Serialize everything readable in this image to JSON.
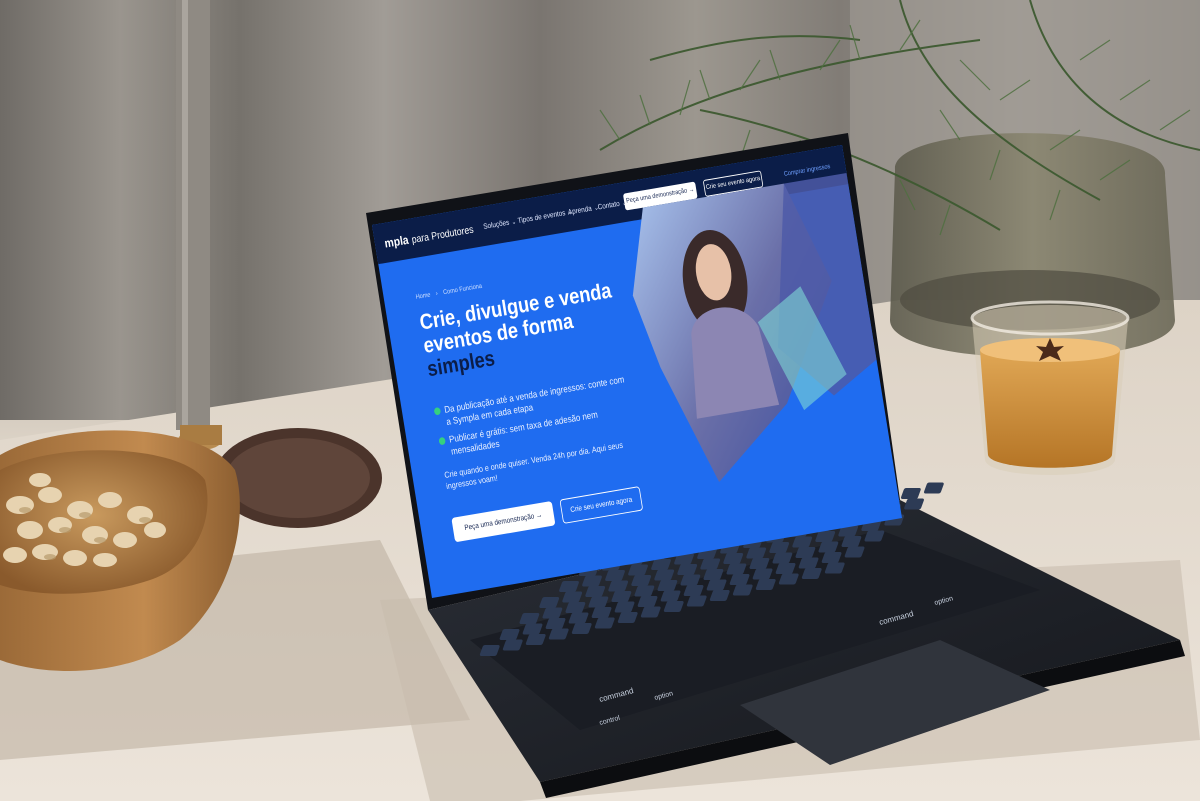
{
  "site": {
    "logo": "mpla",
    "logo_suffix": "para Produtores",
    "nav": [
      "Soluções",
      "Tipos de eventos",
      "Aprenda",
      "Contato"
    ],
    "cta_demo_top": "Peça uma demonstração",
    "cta_create_top": "Crie seu evento agora",
    "buy_tickets": "Comprar ingressos",
    "breadcrumb_home": "Home",
    "breadcrumb_current": "Como Funciona",
    "headline_part1": "Crie, divulgue e venda eventos de forma",
    "headline_part2": "simples",
    "bullet1": "Da publicação até a venda de ingressos: conte com a Sympla em cada etapa",
    "bullet2": "Publicar é grátis: sem taxa de adesão nem mensalidades",
    "tagline": "Crie quando e onde quiser. Venda 24h por dia. Aqui seus ingressos voam!",
    "cta_demo": "Peça uma demonstração",
    "cta_create": "Crie seu evento agora"
  },
  "keyboard_keys": [
    "command",
    "option",
    "control",
    "command",
    "option"
  ],
  "colors": {
    "screen_blue": "#1f6cf0",
    "nav_navy": "#0b1d48",
    "check_green": "#35d07f",
    "table_beige": "#e9e1d6",
    "laptop_black": "#1c1f26"
  },
  "icons": [
    "arrow-right-icon",
    "check-circle-icon",
    "chevron-right-icon"
  ]
}
